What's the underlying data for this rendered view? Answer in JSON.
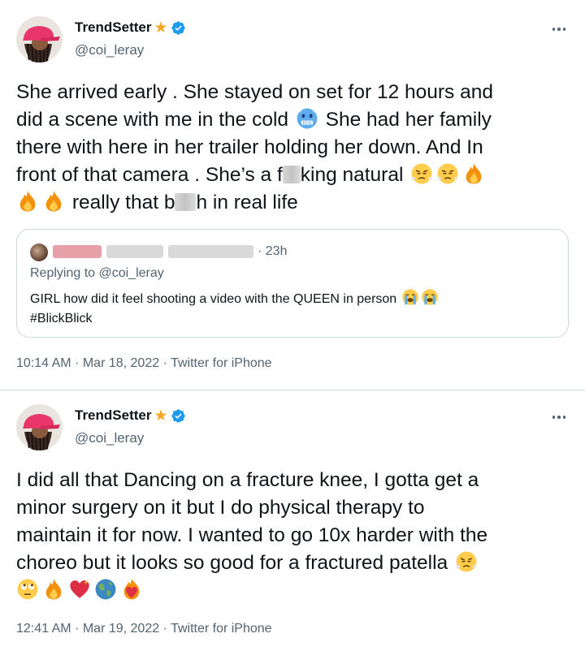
{
  "tweets": [
    {
      "display_name": "TrendSetter",
      "handle": "@coi_leray",
      "text": {
        "l1": "She arrived early . She stayed on set for 12 hours and",
        "l2a": "did a scene with me in the cold",
        "l2b": "She had her family",
        "l3": "there with here in her trailer holding her down. And In",
        "l4a": "front of that camera . She’s a f",
        "l4b": "king natural",
        "l5a": "really that b",
        "l5b": "h in real life"
      },
      "quote": {
        "time": "· 23h",
        "replying_prefix": "Replying to",
        "replying_handle": "@coi_leray",
        "text_a": "GIRL how did it feel shooting a video with the QUEEN in person",
        "text_b": "#BlickBlick"
      },
      "time": "10:14 AM",
      "sep1": "·",
      "date": "Mar 18, 2022",
      "sep2": "·",
      "source": "Twitter for iPhone"
    },
    {
      "display_name": "TrendSetter",
      "handle": "@coi_leray",
      "text": {
        "l1": "I did all that Dancing on a fracture knee, I gotta get a",
        "l2": "minor surgery on it but I do physical therapy to",
        "l3": "maintain it for now. I wanted to go 10x harder with the",
        "l4": "choreo but it looks so good for a fractured patella"
      },
      "time": "12:41 AM",
      "sep1": "·",
      "date": "Mar 19, 2022",
      "sep2": "·",
      "source": "Twitter for iPhone"
    }
  ],
  "icons": {
    "star": "★",
    "verified_color": "#1d9bf0",
    "star_color": "#f5a623"
  }
}
